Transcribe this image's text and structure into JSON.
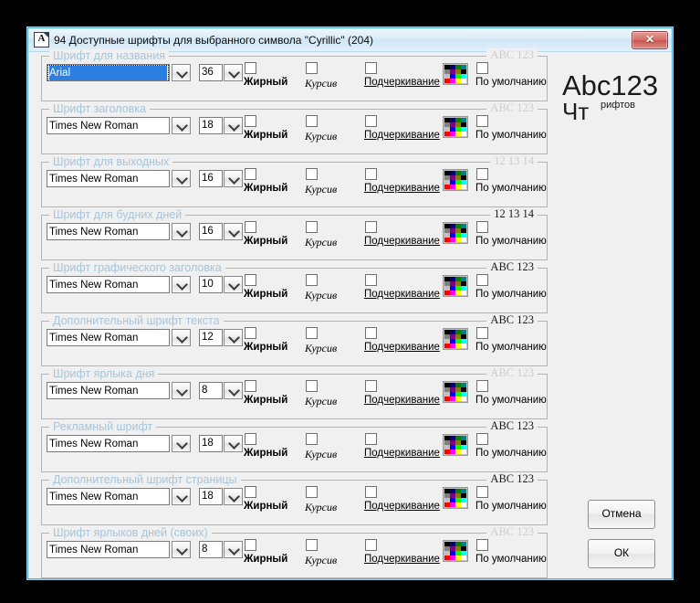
{
  "window": {
    "title": "94 Доступные шрифты для выбранного символа \"Cyrillic\" (204)",
    "icon": "font-file-icon",
    "close_label": "✕",
    "frame_color": "#3fb3e0",
    "background": "#f0f0f0"
  },
  "labels": {
    "bold": "Жирный",
    "italic": "Курсив",
    "underline": "Подчеркивание",
    "default": "По умолчанию"
  },
  "preview": {
    "big": "Abc123",
    "small": "рифтов",
    "cyrillic": "Чт"
  },
  "buttons": {
    "cancel": "Отмена",
    "ok": "ОК"
  },
  "palette": {
    "name": "color-picker-swatch",
    "colors": [
      "#000000",
      "#000080",
      "#008000",
      "#008080",
      "#808080",
      "#800080",
      "#808000",
      "#000000",
      "#c0c0c0",
      "#0000ff",
      "#00ff00",
      "#00ffff",
      "#ff0000",
      "#ff00ff",
      "#ffff00",
      "#ffffff"
    ]
  },
  "groups": [
    {
      "legend": "Шрифт для названия",
      "sample": "ABC 123",
      "sample_dark": false,
      "font": "Arial",
      "size": "36",
      "selected": true,
      "bold": false,
      "italic": false,
      "underline": false,
      "use_default": false
    },
    {
      "legend": "Шрифт заголовка",
      "sample": "ABC 123",
      "sample_dark": false,
      "font": "Times New Roman",
      "size": "18",
      "selected": false,
      "bold": false,
      "italic": false,
      "underline": false,
      "use_default": false
    },
    {
      "legend": "Шрифт для выходных",
      "sample": "12 13 14",
      "sample_dark": false,
      "font": "Times New Roman",
      "size": "16",
      "selected": false,
      "bold": false,
      "italic": false,
      "underline": false,
      "use_default": false
    },
    {
      "legend": "Шрифт для будних дней",
      "sample": "12 13 14",
      "sample_dark": true,
      "font": "Times New Roman",
      "size": "16",
      "selected": false,
      "bold": false,
      "italic": false,
      "underline": false,
      "use_default": false
    },
    {
      "legend": "Шрифт графического заголовка",
      "sample": "ABC 123",
      "sample_dark": true,
      "font": "Times New Roman",
      "size": "10",
      "selected": false,
      "bold": false,
      "italic": false,
      "underline": false,
      "use_default": false
    },
    {
      "legend": "Дополнительный шрифт текста",
      "sample": "ABC 123",
      "sample_dark": true,
      "font": "Times New Roman",
      "size": "12",
      "selected": false,
      "bold": false,
      "italic": false,
      "underline": false,
      "use_default": false
    },
    {
      "legend": "Шрифт ярлыка дня",
      "sample": "ABC 123",
      "sample_dark": false,
      "font": "Times New Roman",
      "size": "8",
      "selected": false,
      "bold": false,
      "italic": false,
      "underline": false,
      "use_default": false
    },
    {
      "legend": "Рекламный шрифт",
      "sample": "ABC 123",
      "sample_dark": true,
      "font": "Times New Roman",
      "size": "18",
      "selected": false,
      "bold": false,
      "italic": false,
      "underline": false,
      "use_default": false
    },
    {
      "legend": "Дополнительный шрифт страницы",
      "sample": "ABC 123",
      "sample_dark": true,
      "font": "Times New Roman",
      "size": "18",
      "selected": false,
      "bold": false,
      "italic": false,
      "underline": false,
      "use_default": false
    },
    {
      "legend": "Шрифт ярлыков дней (своих)",
      "sample": "ABC 123",
      "sample_dark": false,
      "font": "Times New Roman",
      "size": "8",
      "selected": false,
      "bold": false,
      "italic": false,
      "underline": false,
      "use_default": false
    }
  ]
}
